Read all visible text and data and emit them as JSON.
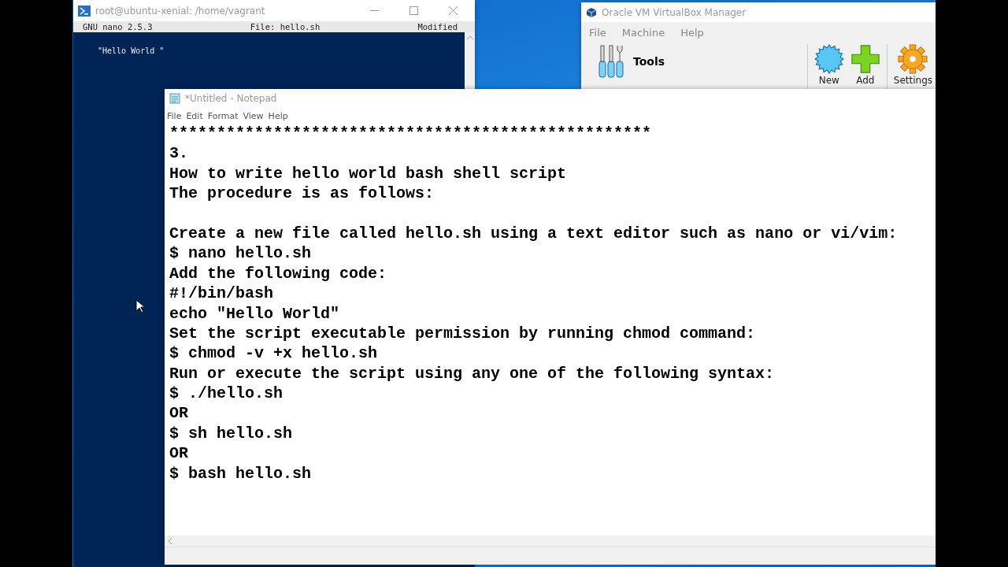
{
  "terminal": {
    "title": "root@ubuntu-xenial: /home/vagrant",
    "nano_header": {
      "version": "GNU nano 2.5.3",
      "file": "File: hello.sh",
      "status": "Modified"
    },
    "content": "\"Hello World \""
  },
  "virtualbox": {
    "title": "Oracle VM VirtualBox Manager",
    "menu": [
      "File",
      "Machine",
      "Help"
    ],
    "tools_label": "Tools",
    "toolbar": [
      {
        "kind": "new",
        "label": "New"
      },
      {
        "kind": "add",
        "label": "Add"
      },
      {
        "kind": "settings",
        "label": "Settings"
      }
    ]
  },
  "notepad": {
    "title": "*Untitled - Notepad",
    "menu": [
      "File",
      "Edit",
      "Format",
      "View",
      "Help"
    ],
    "blocks": [
      [
        "***************************************************",
        "3.",
        "How to write hello world bash shell script",
        "The procedure is as follows:"
      ],
      [
        "Create a new file called hello.sh using a text editor such as nano or vi/vim:",
        "$ nano hello.sh",
        "Add the following code:",
        "#!/bin/bash",
        "echo \"Hello World\"",
        "Set the script executable permission by running chmod command:",
        "$ chmod -v +x hello.sh",
        "Run or execute the script using any one of the following syntax:",
        "$ ./hello.sh",
        "OR",
        "$ sh hello.sh",
        "OR",
        "$ bash hello.sh"
      ]
    ]
  }
}
